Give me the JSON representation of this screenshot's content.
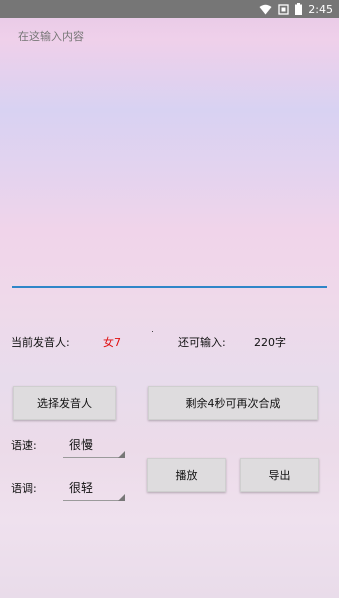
{
  "status_bar": {
    "time": "2:45",
    "icons": [
      "wifi-icon",
      "screenshot-icon",
      "battery-icon"
    ]
  },
  "input": {
    "placeholder": "在这输入内容",
    "value": ""
  },
  "speaker": {
    "label": "当前发音人:",
    "value": "女7"
  },
  "remaining": {
    "label": "还可输入:",
    "value": "220字"
  },
  "buttons": {
    "select_speaker": "选择发音人",
    "synth_cooldown": "剩余4秒可再次合成",
    "play": "播放",
    "export": "导出"
  },
  "speed": {
    "label": "语速:",
    "selected": "很慢"
  },
  "tone": {
    "label": "语调:",
    "selected": "很轻"
  },
  "colors": {
    "accent_underline": "#2f86c8",
    "speaker_value": "#e01010",
    "status_bar": "#767676"
  }
}
